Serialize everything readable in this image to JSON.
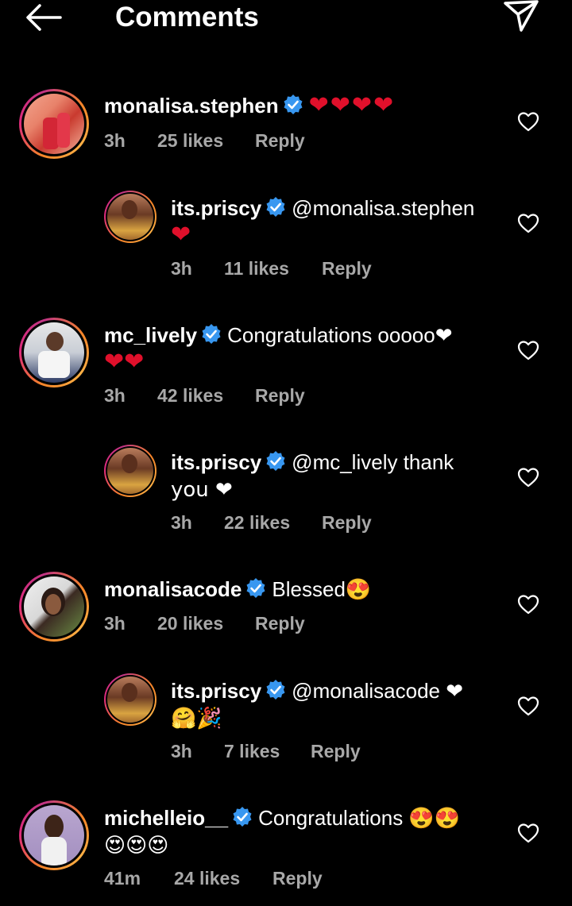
{
  "header": {
    "title": "Comments",
    "back_icon": "arrow-left-icon",
    "send_icon": "paper-plane-icon"
  },
  "colors": {
    "verified": "#3897f0",
    "heart": "#e0102b",
    "meta": "#a8a8a8",
    "ring": "#dd2a7b"
  },
  "comments": [
    {
      "username": "monalisa.stephen",
      "text": "❤️❤️❤️❤️",
      "time": "3h",
      "likes": "25 likes",
      "reply": "Reply",
      "line1": "❤❤❤❤",
      "line2": ""
    },
    {
      "username": "its.priscy",
      "line1": "@monalisa.stephen",
      "line2": "❤",
      "time": "3h",
      "likes": "11 likes",
      "reply": "Reply"
    },
    {
      "username": "mc_lively",
      "line1": "Congratulations ooooo❤",
      "line2": "❤❤",
      "time": "3h",
      "likes": "42 likes",
      "reply": "Reply"
    },
    {
      "username": "its.priscy",
      "line1": "@mc_lively thank",
      "line2": "you ❤",
      "time": "3h",
      "likes": "22 likes",
      "reply": "Reply"
    },
    {
      "username": "monalisacode",
      "line1": "Blessed😍",
      "line2": "",
      "time": "3h",
      "likes": "20 likes",
      "reply": "Reply"
    },
    {
      "username": "its.priscy",
      "line1": "@monalisacode ❤",
      "line2": "🤗🎉",
      "time": "3h",
      "likes": "7 likes",
      "reply": "Reply"
    },
    {
      "username": "michelleio__",
      "line1": "Congratulations 😍😍",
      "line2": "😍😍😍",
      "time": "41m",
      "likes": "24 likes",
      "reply": "Reply"
    }
  ]
}
